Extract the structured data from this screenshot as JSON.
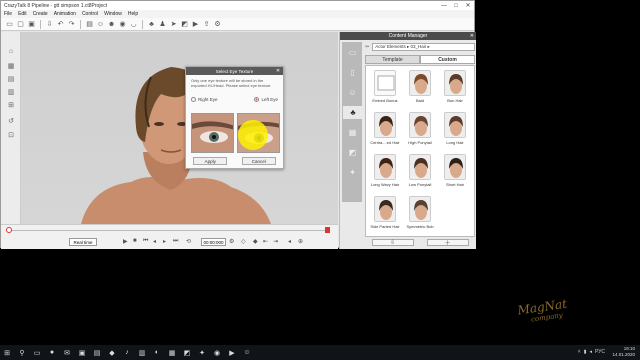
{
  "window": {
    "title": "CrazyTalk 8 Pipeline - ",
    "project_name": "gtt simpson 1.ct8Project",
    "controls": [
      "—",
      "□",
      "✕"
    ]
  },
  "menu": [
    "File",
    "Edit",
    "Create",
    "Animation",
    "Control",
    "Window",
    "Help"
  ],
  "toolbar_icons": [
    "new-icon",
    "open-icon",
    "save-icon",
    "import-icon",
    "undo-icon",
    "redo-icon",
    "scene-icon",
    "actor-icon",
    "face-icon",
    "eye-icon",
    "mouth-icon",
    "hair-icon",
    "body-icon",
    "motion-icon",
    "camera-icon",
    "render-icon",
    "export-icon",
    "settings-icon"
  ],
  "dialog": {
    "title": "Select Eye Texture",
    "description": "Only one eye texture will be stored in the exported HL/Head. Please select eye texture.",
    "options": [
      {
        "label": "Right Eye",
        "selected": false
      },
      {
        "label": "Left Eye",
        "selected": true
      }
    ],
    "apply_label": "Apply",
    "cancel_label": "Cancel"
  },
  "timeline": {
    "realtime_label": "Real time",
    "timecode": "00:00:000"
  },
  "panel": {
    "title": "Content Manager",
    "path": "Actor Elements ▸ 03_Hair ▸",
    "tabs": [
      "Template",
      "Custom"
    ],
    "active_tab": "Custom",
    "items": [
      {
        "label": "Embed Bonus",
        "hair": "#ffffff"
      },
      {
        "label": "Bald",
        "hair": "#7a4a2a"
      },
      {
        "label": "Bun Hair",
        "hair": "#5a3a28"
      },
      {
        "label": "Centra....ed Hair",
        "hair": "#3a2418"
      },
      {
        "label": "High Ponytail",
        "hair": "#6a4430"
      },
      {
        "label": "Long Hair",
        "hair": "#5b3b2a"
      },
      {
        "label": "Long Wavy Hair",
        "hair": "#3d2416"
      },
      {
        "label": "Low Ponytail",
        "hair": "#4a3020"
      },
      {
        "label": "Short Hair",
        "hair": "#2e2018"
      },
      {
        "label": "Side Parted Hair",
        "hair": "#3a2a20"
      },
      {
        "label": "Symmetric Bob",
        "hair": "#5a4030"
      }
    ]
  },
  "watermark": {
    "line1": "MagNat",
    "line2": "company"
  },
  "tray": {
    "lang": "РУС",
    "time": "19:10",
    "date": "14.01.2020"
  }
}
